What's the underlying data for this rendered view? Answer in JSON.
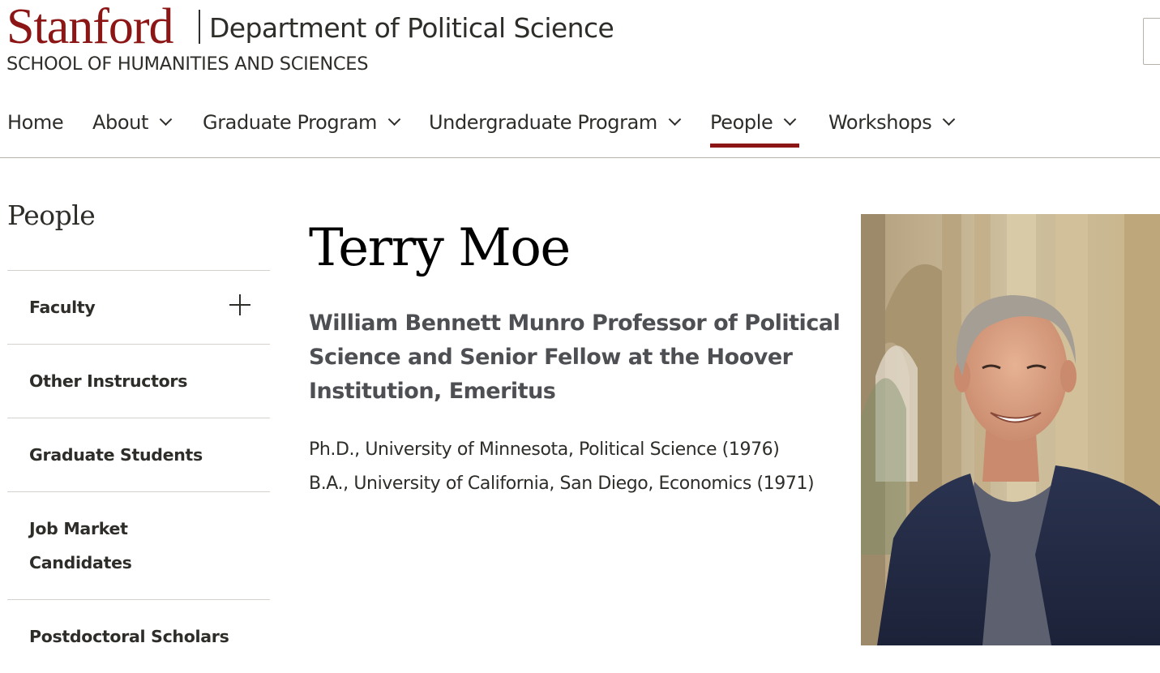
{
  "header": {
    "logo_text": "Stanford",
    "department": "Department of Political Science",
    "school": "SCHOOL OF HUMANITIES AND SCIENCES"
  },
  "nav": {
    "items": [
      {
        "label": "Home",
        "has_dropdown": false
      },
      {
        "label": "About",
        "has_dropdown": true
      },
      {
        "label": "Graduate Program",
        "has_dropdown": true
      },
      {
        "label": "Undergraduate Program",
        "has_dropdown": true
      },
      {
        "label": "People",
        "has_dropdown": true,
        "active": true
      },
      {
        "label": "Workshops",
        "has_dropdown": true
      }
    ]
  },
  "sidebar": {
    "title": "People",
    "items": [
      {
        "label": "Faculty",
        "expandable": true
      },
      {
        "label": "Other Instructors"
      },
      {
        "label": "Graduate Students"
      },
      {
        "label": "Job Market Candidates"
      },
      {
        "label": "Postdoctoral Scholars"
      }
    ]
  },
  "profile": {
    "name": "Terry Moe",
    "title": "William Bennett Munro Professor of Political Science and Senior Fellow at the Hoover Institution, Emeritus",
    "degrees": [
      "Ph.D., University of Minnesota, Political Science (1976)",
      "B.A., University of California, San Diego, Economics (1971)"
    ]
  },
  "colors": {
    "cardinal": "#8c1515",
    "text": "#2e2d29",
    "subtitle": "#4d4f53",
    "divider": "#d5d1cc"
  }
}
